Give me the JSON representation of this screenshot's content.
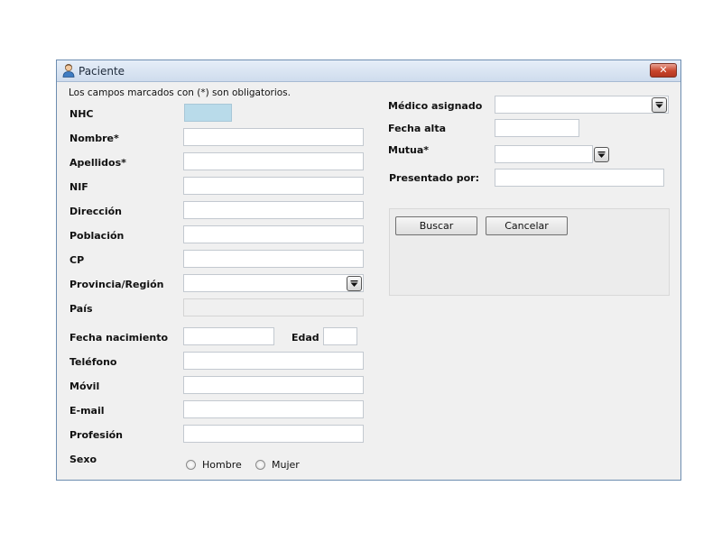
{
  "window": {
    "title": "Paciente",
    "close_label": "✕"
  },
  "form": {
    "required_note": "Los campos marcados con (*) son obligatorios.",
    "labels": {
      "nhc": "NHC",
      "nombre": "Nombre*",
      "apellidos": "Apellidos*",
      "nif": "NIF",
      "direccion": "Dirección",
      "poblacion": "Población",
      "cp": "CP",
      "provincia": "Provincia/Región",
      "pais": "País",
      "fecha_nacimiento": "Fecha nacimiento",
      "edad": "Edad",
      "telefono": "Teléfono",
      "movil": "Móvil",
      "email": "E-mail",
      "profesion": "Profesión",
      "sexo": "Sexo",
      "medico_asignado": "Médico asignado",
      "fecha_alta": "Fecha alta",
      "mutua": "Mutua*",
      "presentado_por": "Presentado por:"
    },
    "sexo_options": {
      "hombre": "Hombre",
      "mujer": "Mujer"
    }
  },
  "actions": {
    "buscar": "Buscar",
    "cancelar": "Cancelar"
  },
  "colors": {
    "nhc_field": "#b9dbea",
    "close_button": "#c8452c"
  }
}
